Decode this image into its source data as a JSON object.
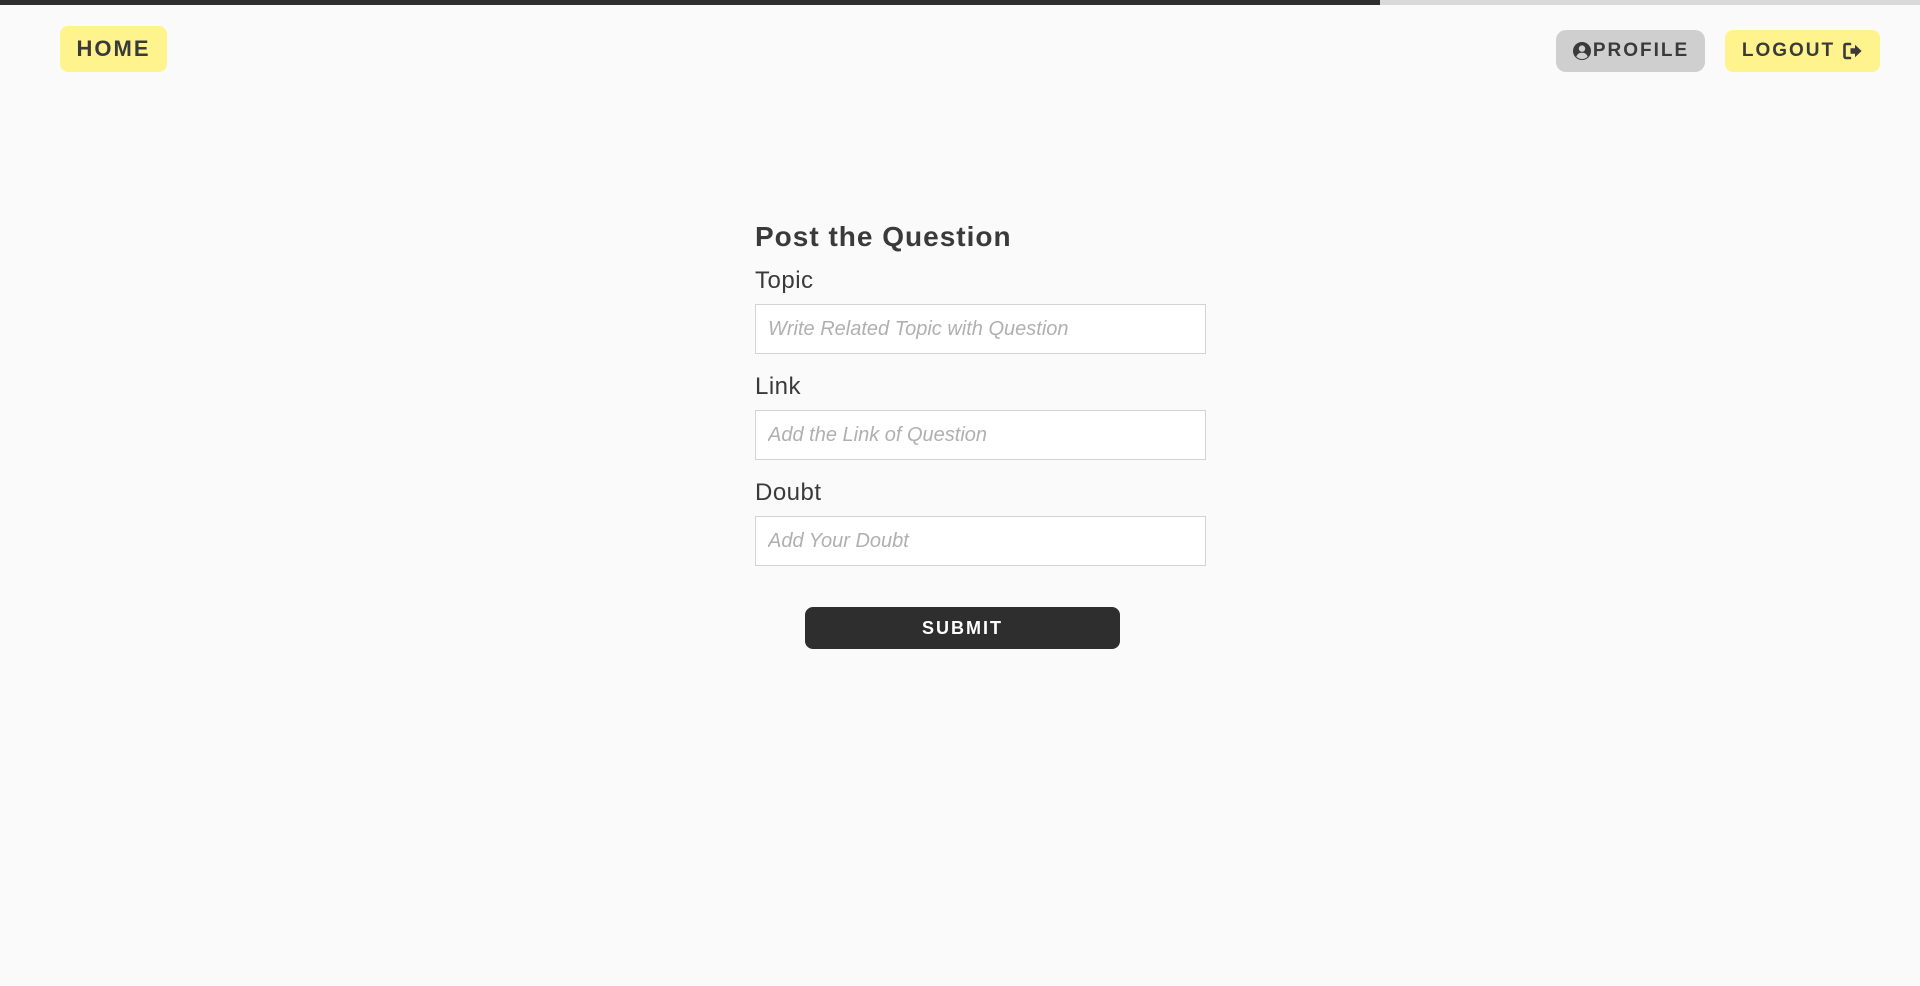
{
  "nav": {
    "home_label": "HOME",
    "profile_label": "PROFILE",
    "logout_label": "LOGOUT",
    "profile_icon": "user-circle-icon",
    "logout_icon": "sign-out-icon"
  },
  "form": {
    "title": "Post the Question",
    "topic": {
      "label": "Topic",
      "placeholder": "Write Related Topic with Question",
      "value": ""
    },
    "link": {
      "label": "Link",
      "placeholder": "Add the Link of Question",
      "value": ""
    },
    "doubt": {
      "label": "Doubt",
      "placeholder": "Add Your Doubt",
      "value": ""
    },
    "submit_label": "SUBMIT"
  },
  "colors": {
    "background": "#fafafa",
    "accent_yellow": "#fff38d",
    "profile_gray": "#cfcfcf",
    "dark": "#2e2e2e",
    "text": "#3a3a3a"
  }
}
